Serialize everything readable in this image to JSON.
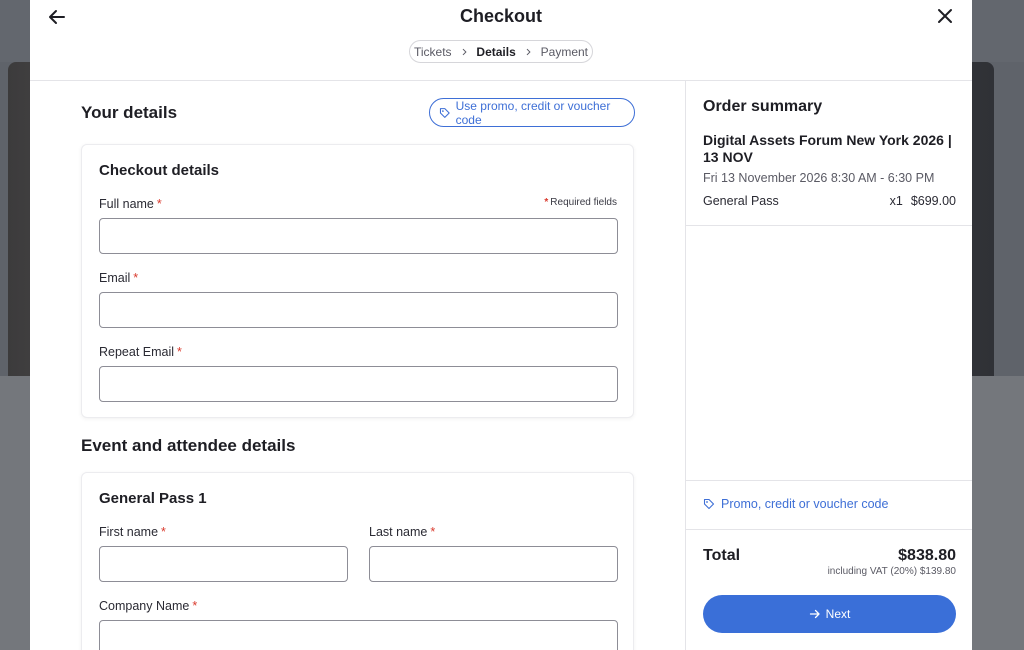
{
  "header": {
    "title": "Checkout",
    "steps": [
      {
        "label": "Tickets"
      },
      {
        "label": "Details"
      },
      {
        "label": "Payment"
      }
    ]
  },
  "left": {
    "your_details_title": "Your details",
    "promo_button_label": "Use promo, credit or voucher code",
    "checkout_card": {
      "title": "Checkout details",
      "required_note": "Required fields",
      "star": "*",
      "fields": [
        {
          "label": "Full name",
          "value": "",
          "placeholder": ""
        },
        {
          "label": "Email",
          "value": "",
          "placeholder": ""
        },
        {
          "label": "Repeat Email",
          "value": "",
          "placeholder": ""
        }
      ]
    },
    "attendee_section_title": "Event and attendee details",
    "pass_card": {
      "title": "General Pass 1",
      "fields": [
        {
          "label": "First name",
          "value": ""
        },
        {
          "label": "Last name",
          "value": ""
        },
        {
          "label": "Company Name",
          "value": ""
        }
      ]
    }
  },
  "summary": {
    "title": "Order summary",
    "event_name": "Digital Assets Forum New York 2026 | 13 NOV",
    "event_date": "Fri 13 November 2026 8:30 AM - 6:30 PM",
    "ticket": {
      "name": "General Pass",
      "qty": "x1",
      "price": "$699.00"
    },
    "promo_link": "Promo, credit or voucher code",
    "total_label": "Total",
    "total_value": "$838.80",
    "vat_note": "including VAT (20%) $139.80",
    "next_label": "Next"
  },
  "colors": {
    "accent": "#3a6fd8",
    "required_star": "#d9392c"
  },
  "icons": {
    "back": "arrow-left-icon",
    "close": "close-icon",
    "chevron": "chevron-right-icon",
    "tag": "tag-icon",
    "next": "arrow-right-icon"
  }
}
